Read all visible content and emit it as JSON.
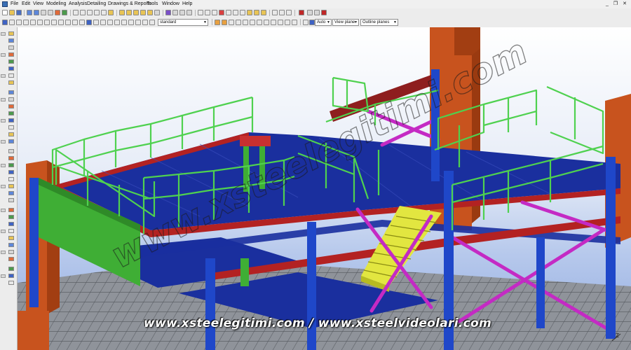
{
  "menu": {
    "items": [
      "File",
      "Edit",
      "View",
      "Modeling",
      "Analysis",
      "Detailing",
      "Drawings & Reports",
      "Tools",
      "Window",
      "Help"
    ]
  },
  "toolbar": {
    "select_filter_value": "standard",
    "snap_mode": "Auto",
    "plane_mode": "View plane",
    "outline_mode": "Outline planes"
  },
  "viewport": {
    "watermark_diagonal": "www.xsteelegitimi.com",
    "footer_urls": "www.xsteelegitimi.com / www.xsteelvideolari.com",
    "axis_label": "Z"
  },
  "colors": {
    "plate_blue": "#1a2f9e",
    "column_blue": "#1f47c9",
    "railing_green": "#4fd14f",
    "beam_red": "#b32222",
    "concrete_orange": "#c8531e",
    "brace_magenta": "#c42ac4",
    "stair_yellow": "#e2e640",
    "grating_grey": "#8f939a"
  }
}
